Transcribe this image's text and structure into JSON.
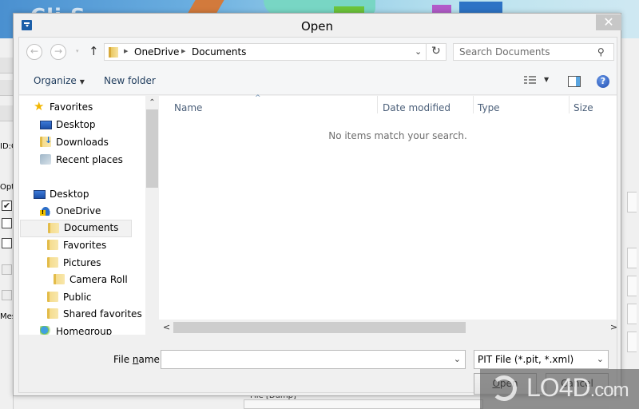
{
  "background_app": {
    "title_fragment": "Cli S",
    "left_labels": [
      "ID:C",
      "Optio",
      "Mess"
    ],
    "left_checkboxes": [
      {
        "checked": true,
        "disabled": false
      },
      {
        "checked": false,
        "disabled": false
      },
      {
        "checked": false,
        "disabled": false
      },
      {
        "checked": false,
        "disabled": true
      },
      {
        "checked": false,
        "disabled": true
      }
    ],
    "bottom_label": "File [Dump]"
  },
  "dialog": {
    "title": "Open",
    "close_glyph": "✕",
    "nav": {
      "back_glyph": "←",
      "forward_glyph": "→",
      "recent_glyph": "▾",
      "up_glyph": "↑",
      "breadcrumb": [
        "OneDrive",
        "Documents"
      ],
      "breadcrumb_sep": "▶",
      "address_dropdown_glyph": "⌄",
      "refresh_glyph": "↻",
      "search_placeholder": "Search Documents",
      "search_glyph": "⚲"
    },
    "toolbar": {
      "organize_label": "Organize",
      "organize_caret": "▼",
      "new_folder_label": "New folder",
      "view_caret": "▼",
      "help_glyph": "?"
    },
    "nav_pane": {
      "items": [
        {
          "label": "Favorites",
          "icon": "star-icon",
          "level": 0
        },
        {
          "label": "Desktop",
          "icon": "monitor-icon",
          "level": 1
        },
        {
          "label": "Downloads",
          "icon": "downloads-folder-icon",
          "level": 1
        },
        {
          "label": "Recent places",
          "icon": "recent-places-icon",
          "level": 1
        },
        {
          "label": "Desktop",
          "icon": "monitor-icon",
          "level": 0
        },
        {
          "label": "OneDrive",
          "icon": "onedrive-cloud-icon",
          "level": 1
        },
        {
          "label": "Documents",
          "icon": "folder-icon",
          "level": 2,
          "selected": true
        },
        {
          "label": "Favorites",
          "icon": "folder-icon",
          "level": 2
        },
        {
          "label": "Pictures",
          "icon": "folder-icon",
          "level": 2
        },
        {
          "label": "Camera Roll",
          "icon": "folder-icon",
          "level": 3
        },
        {
          "label": "Public",
          "icon": "folder-icon",
          "level": 2
        },
        {
          "label": "Shared favorites",
          "icon": "folder-icon",
          "level": 2
        },
        {
          "label": "Homegroup",
          "icon": "homegroup-icon",
          "level": 1
        }
      ],
      "scroll_up_glyph": "⌃",
      "scroll_down_glyph": "⌄"
    },
    "file_list": {
      "columns": [
        "Name",
        "Date modified",
        "Type",
        "Size"
      ],
      "sort_glyph": "^",
      "empty_message": "No items match your search.",
      "scroll_left_glyph": "<",
      "scroll_right_glyph": ">"
    },
    "footer": {
      "file_name_label_pre": "File ",
      "file_name_label_accel": "n",
      "file_name_label_post": "ame:",
      "file_name_value": "",
      "file_name_chevron": "⌄",
      "file_type_value": "PIT File (*.pit, *.xml)",
      "file_type_chevron": "⌄",
      "open_accel": "O",
      "open_rest": "pen",
      "cancel_label": "Cancel"
    }
  },
  "watermark": {
    "brand": "LO4D",
    "suffix": ".com"
  }
}
